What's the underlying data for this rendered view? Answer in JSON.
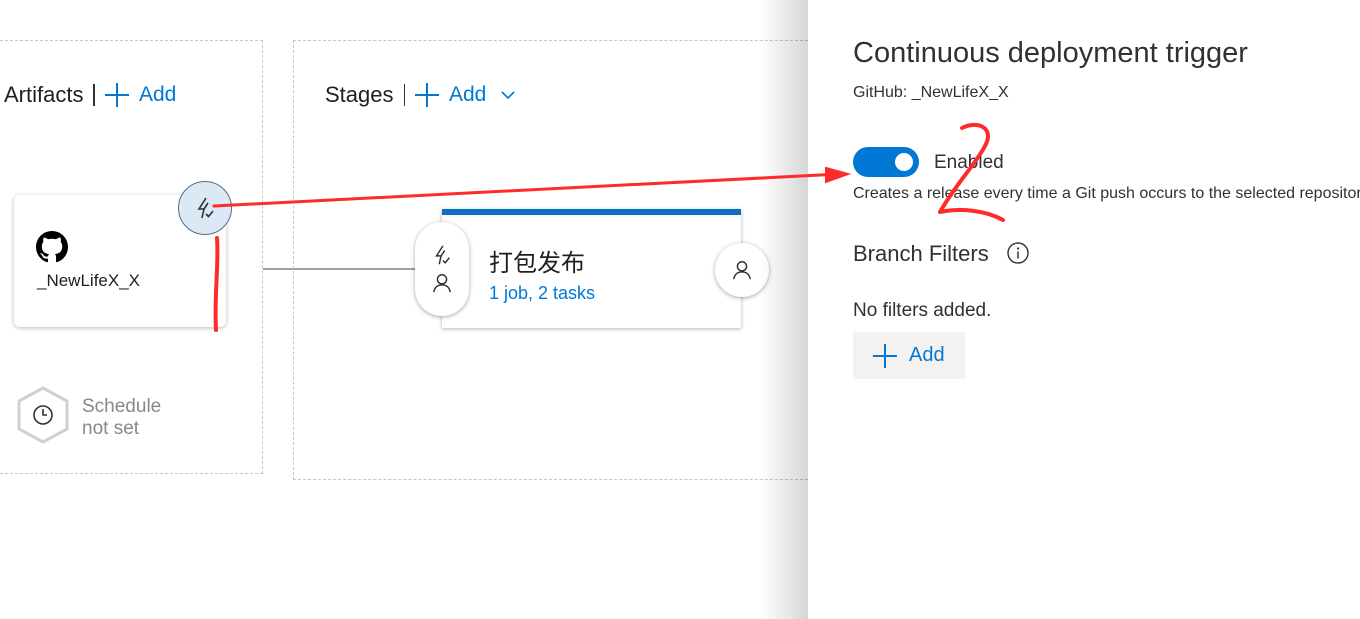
{
  "artifacts": {
    "title": "Artifacts",
    "add_label": "Add",
    "artifact_name": "_NewLifeX_X",
    "schedule_text_line1": "Schedule",
    "schedule_text_line2": "not set"
  },
  "stages": {
    "title": "Stages",
    "add_label": "Add",
    "stage_name": "打包发布",
    "stage_sub": "1 job, 2 tasks"
  },
  "panel": {
    "title": "Continuous deployment trigger",
    "subtitle": "GitHub: _NewLifeX_X",
    "toggle_label": "Enabled",
    "toggle_on": true,
    "toggle_description": "Creates a release every time a Git push occurs to the selected repository",
    "branch_filters_title": "Branch Filters",
    "no_filters_text": "No filters added.",
    "add_label": "Add"
  },
  "annotations": {
    "handwritten_number": "2",
    "color": "#ff2a2a"
  },
  "colors": {
    "accent": "#0078d4",
    "stage_bar": "#106ebe",
    "trigger_bg": "#dbe8f6"
  },
  "icons": [
    "plus-icon",
    "chevron-down-icon",
    "github-icon",
    "lightning-icon",
    "person-icon",
    "clock-icon",
    "info-icon"
  ]
}
